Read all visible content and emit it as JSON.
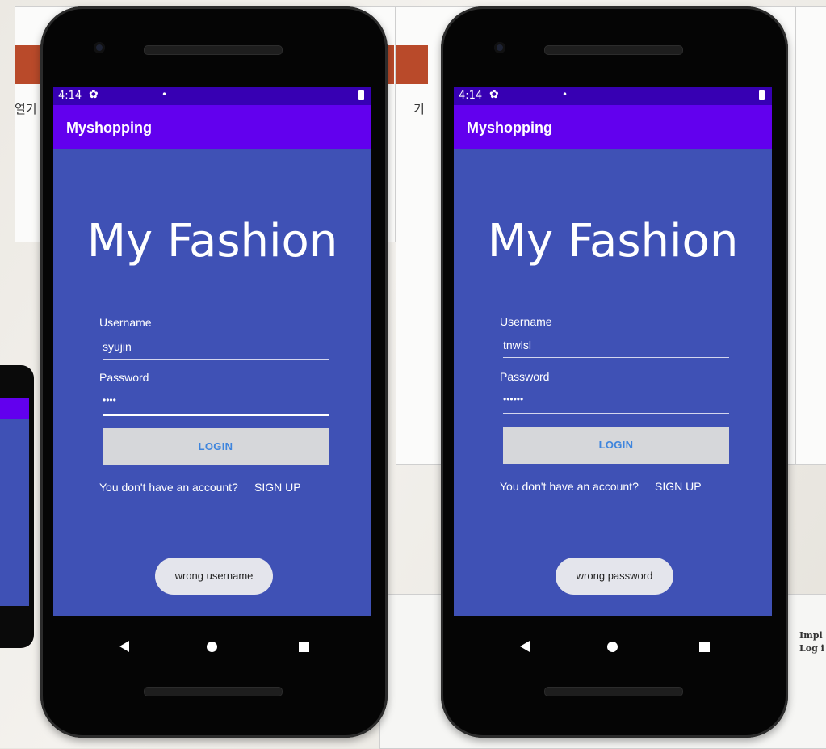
{
  "phones": [
    {
      "status_bar": {
        "time": "4:14"
      },
      "app_bar": {
        "title": "Myshopping"
      },
      "hero_title": "My Fashion",
      "username": {
        "label": "Username",
        "value": "syujin"
      },
      "password": {
        "label": "Password",
        "masked_value": "••••"
      },
      "login_button": "LOGIN",
      "no_account_text": "You don't have an account?",
      "signup_link": "SIGN UP",
      "toast": "wrong username"
    },
    {
      "status_bar": {
        "time": "4:14"
      },
      "app_bar": {
        "title": "Myshopping"
      },
      "hero_title": "My Fashion",
      "username": {
        "label": "Username",
        "value": "tnwlsl"
      },
      "password": {
        "label": "Password",
        "masked_value": "••••••"
      },
      "login_button": "LOGIN",
      "no_account_text": "You don't have an account?",
      "signup_link": "SIGN UP",
      "toast": "wrong password"
    }
  ],
  "background": {
    "left_window_fragment": "열기",
    "right_window_fragment": "기",
    "bottom_right_line1": "Impl",
    "bottom_right_line2": "Log i"
  },
  "colors": {
    "screen_bg": "#3f51b5",
    "status_bar": "#3700b3",
    "app_bar": "#6200ee",
    "button_bg": "#d6d7da",
    "button_text": "#3f85dd",
    "toast_bg": "#e4e5ec"
  },
  "icons": [
    "settings-gear-icon",
    "battery-icon",
    "nav-back-icon",
    "nav-home-icon",
    "nav-recents-icon"
  ]
}
